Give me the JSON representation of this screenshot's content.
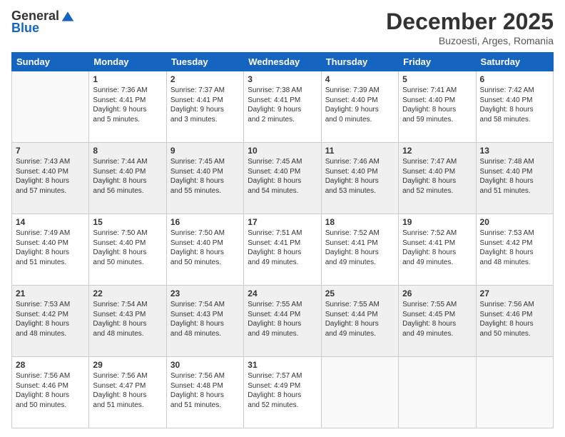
{
  "logo": {
    "general": "General",
    "blue": "Blue"
  },
  "header": {
    "month": "December 2025",
    "location": "Buzoesti, Arges, Romania"
  },
  "days": [
    "Sunday",
    "Monday",
    "Tuesday",
    "Wednesday",
    "Thursday",
    "Friday",
    "Saturday"
  ],
  "weeks": [
    [
      {
        "day": "",
        "text": ""
      },
      {
        "day": "1",
        "text": "Sunrise: 7:36 AM\nSunset: 4:41 PM\nDaylight: 9 hours\nand 5 minutes."
      },
      {
        "day": "2",
        "text": "Sunrise: 7:37 AM\nSunset: 4:41 PM\nDaylight: 9 hours\nand 3 minutes."
      },
      {
        "day": "3",
        "text": "Sunrise: 7:38 AM\nSunset: 4:41 PM\nDaylight: 9 hours\nand 2 minutes."
      },
      {
        "day": "4",
        "text": "Sunrise: 7:39 AM\nSunset: 4:40 PM\nDaylight: 9 hours\nand 0 minutes."
      },
      {
        "day": "5",
        "text": "Sunrise: 7:41 AM\nSunset: 4:40 PM\nDaylight: 8 hours\nand 59 minutes."
      },
      {
        "day": "6",
        "text": "Sunrise: 7:42 AM\nSunset: 4:40 PM\nDaylight: 8 hours\nand 58 minutes."
      }
    ],
    [
      {
        "day": "7",
        "text": "Sunrise: 7:43 AM\nSunset: 4:40 PM\nDaylight: 8 hours\nand 57 minutes."
      },
      {
        "day": "8",
        "text": "Sunrise: 7:44 AM\nSunset: 4:40 PM\nDaylight: 8 hours\nand 56 minutes."
      },
      {
        "day": "9",
        "text": "Sunrise: 7:45 AM\nSunset: 4:40 PM\nDaylight: 8 hours\nand 55 minutes."
      },
      {
        "day": "10",
        "text": "Sunrise: 7:45 AM\nSunset: 4:40 PM\nDaylight: 8 hours\nand 54 minutes."
      },
      {
        "day": "11",
        "text": "Sunrise: 7:46 AM\nSunset: 4:40 PM\nDaylight: 8 hours\nand 53 minutes."
      },
      {
        "day": "12",
        "text": "Sunrise: 7:47 AM\nSunset: 4:40 PM\nDaylight: 8 hours\nand 52 minutes."
      },
      {
        "day": "13",
        "text": "Sunrise: 7:48 AM\nSunset: 4:40 PM\nDaylight: 8 hours\nand 51 minutes."
      }
    ],
    [
      {
        "day": "14",
        "text": "Sunrise: 7:49 AM\nSunset: 4:40 PM\nDaylight: 8 hours\nand 51 minutes."
      },
      {
        "day": "15",
        "text": "Sunrise: 7:50 AM\nSunset: 4:40 PM\nDaylight: 8 hours\nand 50 minutes."
      },
      {
        "day": "16",
        "text": "Sunrise: 7:50 AM\nSunset: 4:40 PM\nDaylight: 8 hours\nand 50 minutes."
      },
      {
        "day": "17",
        "text": "Sunrise: 7:51 AM\nSunset: 4:41 PM\nDaylight: 8 hours\nand 49 minutes."
      },
      {
        "day": "18",
        "text": "Sunrise: 7:52 AM\nSunset: 4:41 PM\nDaylight: 8 hours\nand 49 minutes."
      },
      {
        "day": "19",
        "text": "Sunrise: 7:52 AM\nSunset: 4:41 PM\nDaylight: 8 hours\nand 49 minutes."
      },
      {
        "day": "20",
        "text": "Sunrise: 7:53 AM\nSunset: 4:42 PM\nDaylight: 8 hours\nand 48 minutes."
      }
    ],
    [
      {
        "day": "21",
        "text": "Sunrise: 7:53 AM\nSunset: 4:42 PM\nDaylight: 8 hours\nand 48 minutes."
      },
      {
        "day": "22",
        "text": "Sunrise: 7:54 AM\nSunset: 4:43 PM\nDaylight: 8 hours\nand 48 minutes."
      },
      {
        "day": "23",
        "text": "Sunrise: 7:54 AM\nSunset: 4:43 PM\nDaylight: 8 hours\nand 48 minutes."
      },
      {
        "day": "24",
        "text": "Sunrise: 7:55 AM\nSunset: 4:44 PM\nDaylight: 8 hours\nand 49 minutes."
      },
      {
        "day": "25",
        "text": "Sunrise: 7:55 AM\nSunset: 4:44 PM\nDaylight: 8 hours\nand 49 minutes."
      },
      {
        "day": "26",
        "text": "Sunrise: 7:55 AM\nSunset: 4:45 PM\nDaylight: 8 hours\nand 49 minutes."
      },
      {
        "day": "27",
        "text": "Sunrise: 7:56 AM\nSunset: 4:46 PM\nDaylight: 8 hours\nand 50 minutes."
      }
    ],
    [
      {
        "day": "28",
        "text": "Sunrise: 7:56 AM\nSunset: 4:46 PM\nDaylight: 8 hours\nand 50 minutes."
      },
      {
        "day": "29",
        "text": "Sunrise: 7:56 AM\nSunset: 4:47 PM\nDaylight: 8 hours\nand 51 minutes."
      },
      {
        "day": "30",
        "text": "Sunrise: 7:56 AM\nSunset: 4:48 PM\nDaylight: 8 hours\nand 51 minutes."
      },
      {
        "day": "31",
        "text": "Sunrise: 7:57 AM\nSunset: 4:49 PM\nDaylight: 8 hours\nand 52 minutes."
      },
      {
        "day": "",
        "text": ""
      },
      {
        "day": "",
        "text": ""
      },
      {
        "day": "",
        "text": ""
      }
    ]
  ]
}
